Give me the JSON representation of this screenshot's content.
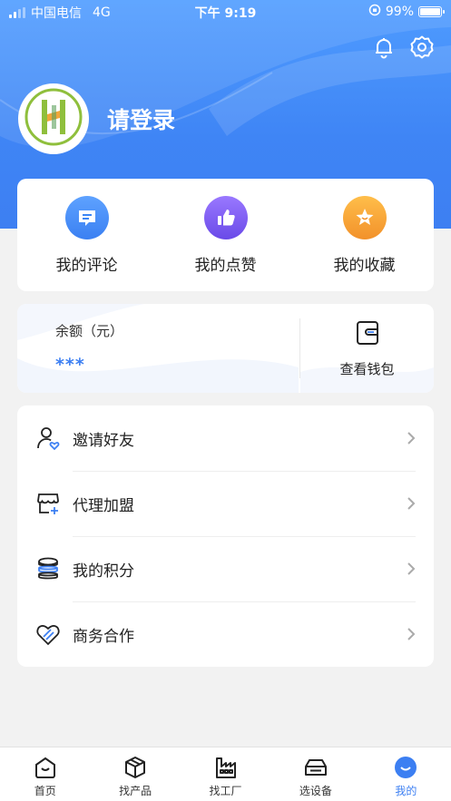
{
  "status_bar": {
    "carrier": "中国电信",
    "network": "4G",
    "time": "下午 9:19",
    "battery": "99%"
  },
  "header": {
    "login_text": "请登录",
    "avatar_icon": "brand-logo-icon",
    "icons": [
      "bell-icon",
      "gear-icon"
    ]
  },
  "actions": [
    {
      "label": "我的评论",
      "icon": "comment-icon",
      "color": "#3b86f5"
    },
    {
      "label": "我的点赞",
      "icon": "thumbs-up-icon",
      "color": "#7a5cf0"
    },
    {
      "label": "我的收藏",
      "icon": "star-icon",
      "color": "#f7a12b"
    }
  ],
  "wallet": {
    "balance_label": "余额（元）",
    "balance_value": "***",
    "view_label": "查看钱包",
    "icon": "wallet-icon"
  },
  "menu": [
    {
      "label": "邀请好友",
      "icon": "invite-user-icon"
    },
    {
      "label": "代理加盟",
      "icon": "store-add-icon"
    },
    {
      "label": "我的积分",
      "icon": "points-stack-icon"
    },
    {
      "label": "商务合作",
      "icon": "handshake-heart-icon"
    }
  ],
  "tabbar": [
    {
      "label": "首页",
      "icon": "home-icon",
      "active": false
    },
    {
      "label": "找产品",
      "icon": "box-icon",
      "active": false
    },
    {
      "label": "找工厂",
      "icon": "factory-icon",
      "active": false
    },
    {
      "label": "选设备",
      "icon": "device-icon",
      "active": false
    },
    {
      "label": "我的",
      "icon": "profile-smile-icon",
      "active": true
    }
  ],
  "colors": {
    "primary": "#3c7ff2",
    "background": "#f2f2f2"
  }
}
